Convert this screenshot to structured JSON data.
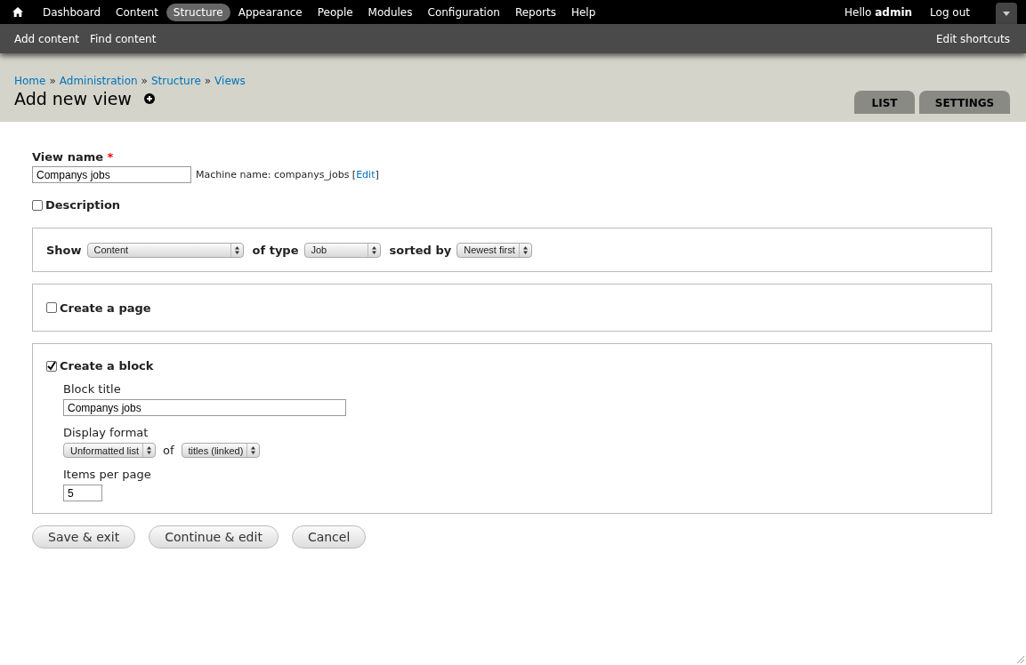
{
  "toolbar": {
    "items": [
      {
        "label": "Dashboard",
        "selected": false
      },
      {
        "label": "Content",
        "selected": false
      },
      {
        "label": "Structure",
        "selected": true
      },
      {
        "label": "Appearance",
        "selected": false
      },
      {
        "label": "People",
        "selected": false
      },
      {
        "label": "Modules",
        "selected": false
      },
      {
        "label": "Configuration",
        "selected": false
      },
      {
        "label": "Reports",
        "selected": false
      },
      {
        "label": "Help",
        "selected": false
      }
    ],
    "greeting": "Hello **admin**",
    "logout": "Log out"
  },
  "shortcuts": {
    "items": [
      "Add content",
      "Find content"
    ],
    "edit": "Edit shortcuts"
  },
  "breadcrumb": {
    "links": [
      "Home",
      "Administration",
      "Structure",
      "Views"
    ],
    "separators": [
      "»",
      "»",
      "»"
    ]
  },
  "page_title": "Add new view",
  "tabs": [
    {
      "label": "LIST",
      "selected": false
    },
    {
      "label": "SETTINGS",
      "selected": false
    }
  ],
  "view_name": {
    "label": "View name",
    "required": "*",
    "value": "Companys jobs",
    "machine_name": "Machine name: companys_jobs",
    "bracket_open": "[",
    "edit_link": "Edit",
    "bracket_close": "]"
  },
  "description": {
    "label": "Description",
    "checked": false
  },
  "show": {
    "parts": [
      {
        "kind": "label",
        "text": "Show"
      },
      {
        "kind": "select",
        "value": "Content"
      },
      {
        "kind": "label",
        "text": "of type"
      },
      {
        "kind": "select",
        "value": "Job"
      },
      {
        "kind": "label",
        "text": "sorted by"
      },
      {
        "kind": "select",
        "value": "Newest first"
      }
    ]
  },
  "page": {
    "label": "Create a page",
    "checked": false
  },
  "block": {
    "label": "Create a block",
    "checked": true,
    "fields": [
      {
        "kind": "text",
        "label": "Block title",
        "value": "Companys jobs"
      },
      {
        "kind": "selects",
        "label": "Display format",
        "parts": [
          {
            "kind": "select",
            "value": "Unformatted list"
          },
          {
            "kind": "word",
            "text": "of"
          },
          {
            "kind": "select",
            "value": "titles (linked)"
          }
        ]
      },
      {
        "kind": "short_text",
        "label": "Items per page",
        "value": "5"
      }
    ]
  },
  "buttons": [
    "Save & exit",
    "Continue & edit",
    "Cancel"
  ]
}
